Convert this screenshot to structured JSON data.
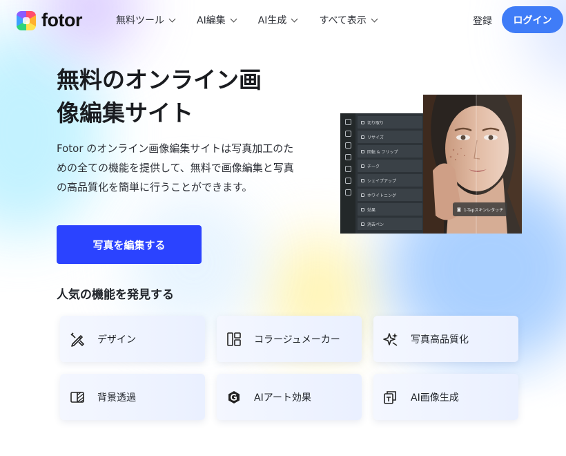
{
  "brand": {
    "name": "fotor"
  },
  "nav": {
    "items": [
      {
        "label": "無料ツール"
      },
      {
        "label": "AI編集"
      },
      {
        "label": "AI生成"
      },
      {
        "label": "すべて表示"
      }
    ],
    "signup_label": "登録",
    "login_label": "ログイン"
  },
  "hero": {
    "title_line1": "無料のオンライン画",
    "title_line2": "像編集サイト",
    "description": "Fotor のオンライン画像編集サイトは写真加工のための全ての機能を提供して、無料で画像編集と写真の高品質化を簡単に行うことができます。",
    "cta_label": "写真を編集する"
  },
  "preview": {
    "panel_items": [
      "切り取り",
      "リサイズ",
      "回転 & フリップ",
      "チーク",
      "シェイプアップ",
      "ホワイトニング",
      "効果",
      "消去ペン"
    ],
    "retouch_badge": "1-Tapスキンレタッチ"
  },
  "features": {
    "title": "人気の機能を発見する",
    "cards": [
      {
        "label": "デザイン",
        "icon": "design-pen-icon"
      },
      {
        "label": "コラージュメーカー",
        "icon": "collage-layout-icon"
      },
      {
        "label": "写真高品質化",
        "icon": "enhance-sparkle-icon"
      },
      {
        "label": "背景透過",
        "icon": "background-remove-icon"
      },
      {
        "label": "AIアート効果",
        "icon": "ai-art-icon"
      },
      {
        "label": "AI画像生成",
        "icon": "ai-image-generate-icon"
      }
    ]
  },
  "colors": {
    "login_button": "#3f7cf7",
    "cta_button": "#2b43ff",
    "card_bg": "#eef3ff"
  }
}
